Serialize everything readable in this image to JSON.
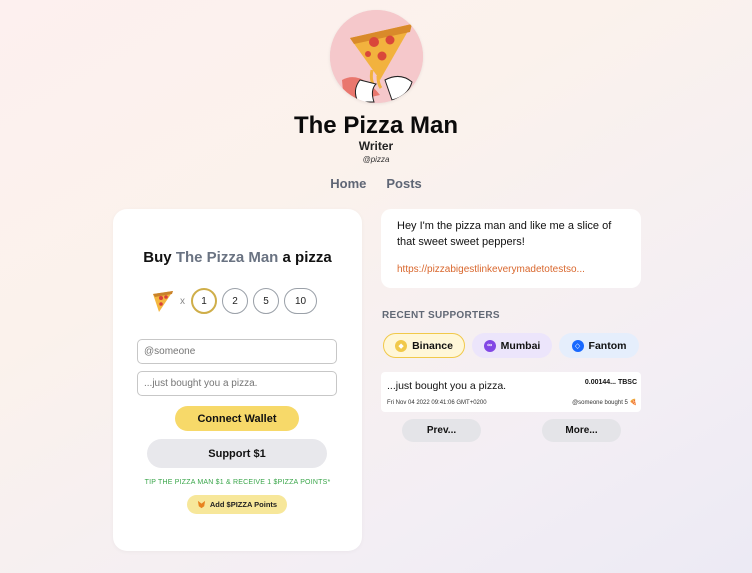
{
  "profile": {
    "name": "The Pizza Man",
    "role": "Writer",
    "handle": "@pizza"
  },
  "nav": {
    "home": "Home",
    "posts": "Posts"
  },
  "buy": {
    "title_prefix": "Buy",
    "title_name": "The Pizza Man",
    "title_suffix": "a pizza",
    "times": "x",
    "quantities": [
      "1",
      "2",
      "5",
      "10"
    ],
    "selected_quantity": "1",
    "name_placeholder": "@someone",
    "message_placeholder": "...just bought you a pizza.",
    "connect_label": "Connect Wallet",
    "support_label": "Support $1",
    "tip_text": "TIP THE PIZZA MAN $1 & RECEIVE 1 $PIZZA POINTS*",
    "add_points_label": "Add $PIZZA Points"
  },
  "bio": {
    "text": "Hey I'm the pizza man and like me a slice of that sweet sweet peppers!",
    "link": "https://pizzabigestlinkeverymadetotestso..."
  },
  "supporters": {
    "heading": "RECENT SUPPORTERS",
    "networks": [
      {
        "label": "Binance",
        "selected": true,
        "color": "#f1c94a"
      },
      {
        "label": "Mumbai",
        "selected": false,
        "color": "#8247e5"
      },
      {
        "label": "Fantom",
        "selected": false,
        "color": "#1969ff"
      }
    ],
    "transactions": [
      {
        "message": "...just bought you a pizza.",
        "amount": "0.00144... TBSC",
        "date": "Fri Nov 04 2022 09:41:06 GMT+0200",
        "who": "@someone bought 5 🍕"
      }
    ],
    "prev_label": "Prev...",
    "more_label": "More..."
  },
  "colors": {
    "accent_yellow": "#f7d969",
    "link_orange": "#d9672d",
    "tip_green": "#3aa64a"
  }
}
